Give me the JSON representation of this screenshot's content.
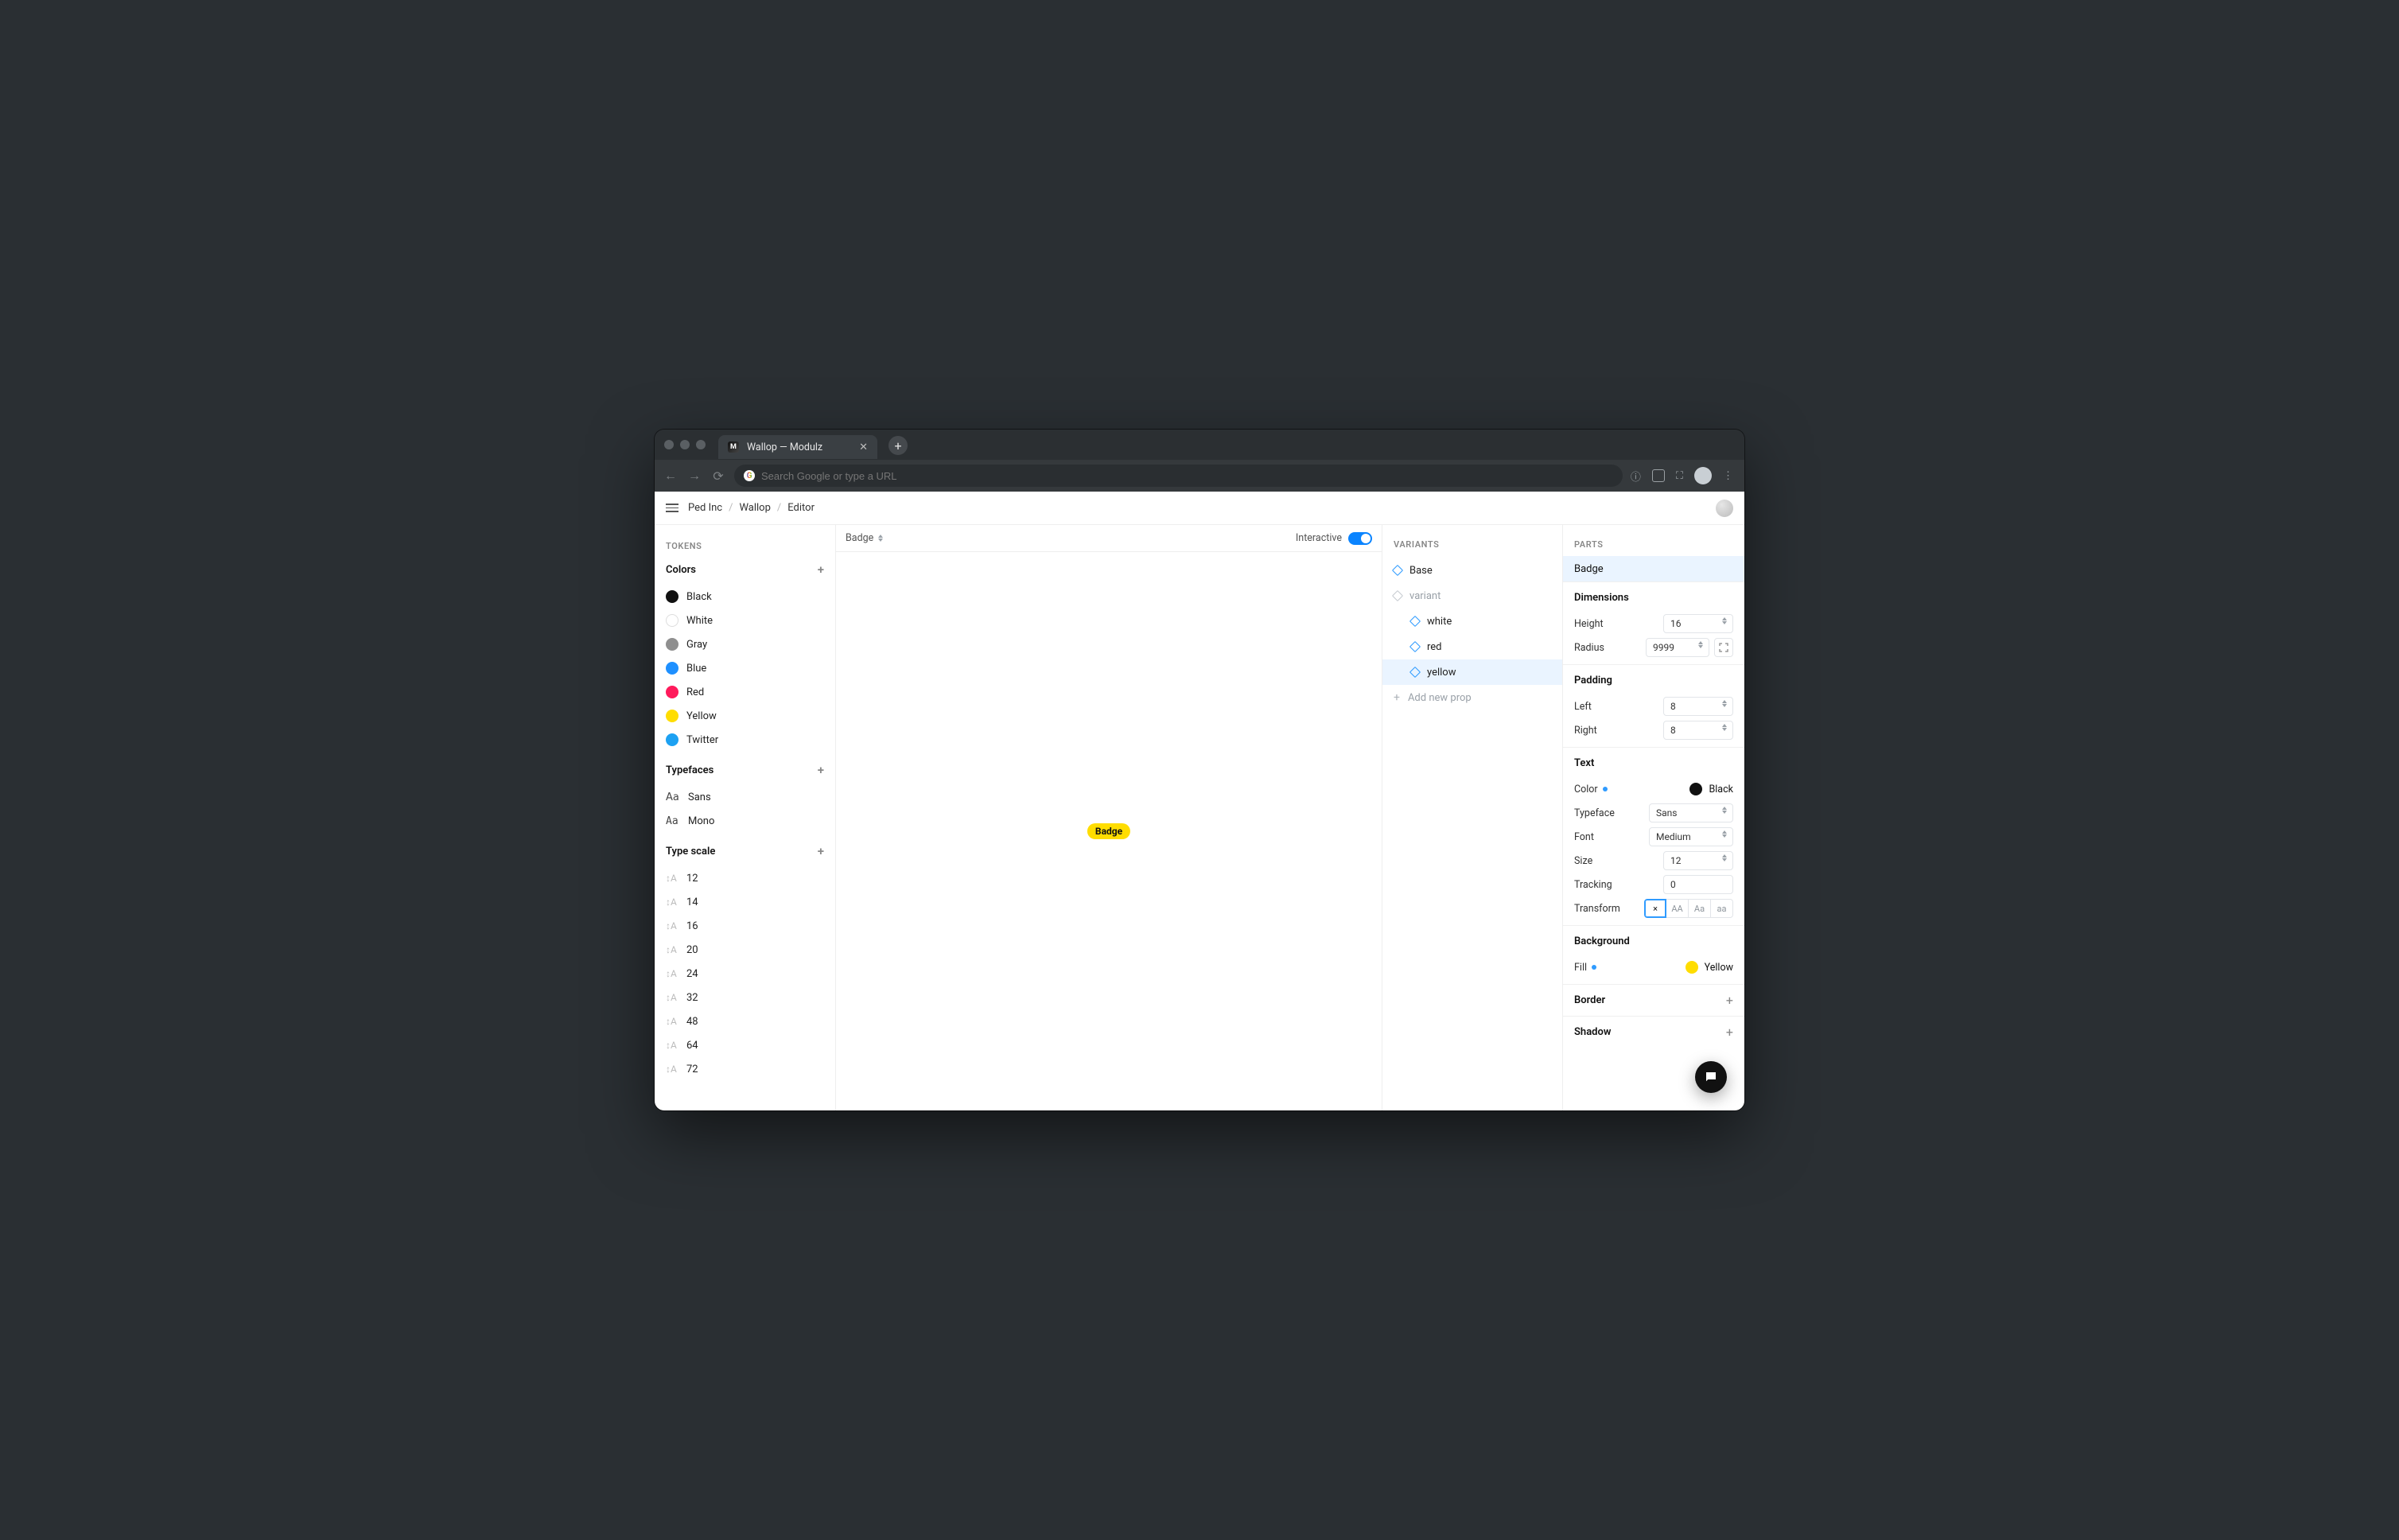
{
  "browser": {
    "tab_title": "Wallop — Modulz",
    "omnibox_placeholder": "Search Google or type a URL"
  },
  "breadcrumbs": {
    "org": "Ped Inc",
    "project": "Wallop",
    "page": "Editor"
  },
  "tokens": {
    "title": "TOKENS",
    "colors_label": "Colors",
    "colors": [
      {
        "name": "Black",
        "hex": "#111111"
      },
      {
        "name": "White",
        "hex": "#ffffff"
      },
      {
        "name": "Gray",
        "hex": "#8f8f8f"
      },
      {
        "name": "Blue",
        "hex": "#1e90ff"
      },
      {
        "name": "Red",
        "hex": "#ff1a5b"
      },
      {
        "name": "Yellow",
        "hex": "#ffdd00"
      },
      {
        "name": "Twitter",
        "hex": "#1da1f2"
      }
    ],
    "typefaces_label": "Typefaces",
    "typefaces": [
      {
        "name": "Sans",
        "mono": false
      },
      {
        "name": "Mono",
        "mono": true
      }
    ],
    "typescale_label": "Type scale",
    "typescale": [
      "12",
      "14",
      "16",
      "20",
      "24",
      "32",
      "48",
      "64",
      "72"
    ]
  },
  "canvas": {
    "component_selector": "Badge",
    "interactive_label": "Interactive",
    "interactive_on": true,
    "preview_text": "Badge"
  },
  "variants": {
    "title": "VARIANTS",
    "base_label": "Base",
    "prop_label": "variant",
    "options": [
      "white",
      "red",
      "yellow"
    ],
    "selected": "yellow",
    "add_label": "Add new prop"
  },
  "inspector": {
    "title": "PARTS",
    "part_selected": "Badge",
    "dimensions": {
      "heading": "Dimensions",
      "height_label": "Height",
      "height": "16",
      "radius_label": "Radius",
      "radius": "9999"
    },
    "padding": {
      "heading": "Padding",
      "left_label": "Left",
      "left": "8",
      "right_label": "Right",
      "right": "8"
    },
    "text": {
      "heading": "Text",
      "color_label": "Color",
      "color_name": "Black",
      "color_hex": "#111111",
      "typeface_label": "Typeface",
      "typeface": "Sans",
      "font_label": "Font",
      "font": "Medium",
      "size_label": "Size",
      "size": "12",
      "tracking_label": "Tracking",
      "tracking": "0",
      "transform_label": "Transform",
      "transform_options": [
        "×",
        "AA",
        "Aa",
        "aa"
      ],
      "transform_selected": "×"
    },
    "background": {
      "heading": "Background",
      "fill_label": "Fill",
      "fill_name": "Yellow",
      "fill_hex": "#ffdd00"
    },
    "border_label": "Border",
    "shadow_label": "Shadow"
  }
}
